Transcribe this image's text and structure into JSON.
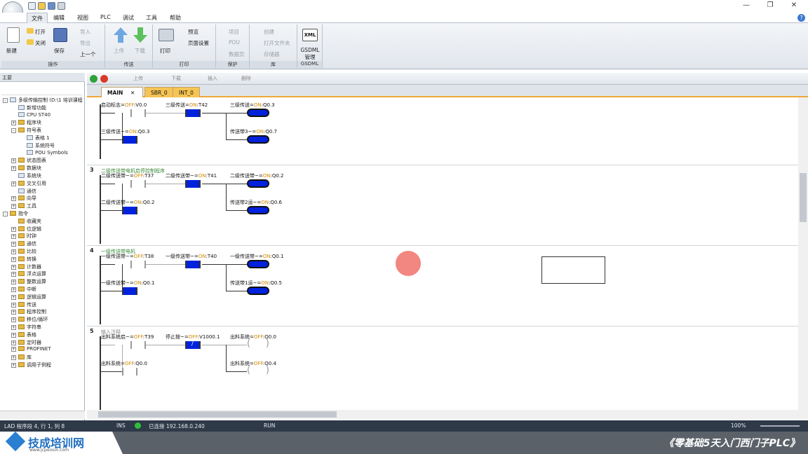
{
  "quick_access": [
    "new-icon",
    "open-icon",
    "save-icon",
    "print-icon"
  ],
  "window_controls": {
    "minimize": "—",
    "maximize": "❐",
    "close": "✕"
  },
  "menu": {
    "tabs": [
      "文件",
      "编辑",
      "视图",
      "PLC",
      "调试",
      "工具",
      "帮助"
    ],
    "active": 0
  },
  "ribbon": {
    "groups": [
      {
        "label": "操作",
        "items": [
          "新建",
          "打开",
          "关闭",
          "保存",
          "导入",
          "导出",
          "上一个"
        ]
      },
      {
        "label": "传送",
        "items": [
          "上传",
          "下载"
        ]
      },
      {
        "label": "打印",
        "items": [
          "打印",
          "预览",
          "页面设置"
        ]
      },
      {
        "label": "保护",
        "items": [
          "项目",
          "POU",
          "数据页"
        ]
      },
      {
        "label": "库",
        "items": [
          "创建",
          "打开文件夹",
          "存储器"
        ]
      },
      {
        "label": "GSDML",
        "items": [
          "GSDML 管理"
        ]
      }
    ],
    "xml_badge": "XML"
  },
  "left_pane": {
    "title": "主要",
    "tree": [
      {
        "label": "多级传输控制 (D:\\1 培训课程",
        "level": 0,
        "type": "root",
        "exp": "⊟"
      },
      {
        "label": "新增功能",
        "level": 1,
        "type": "item"
      },
      {
        "label": "CPU ST40",
        "level": 1,
        "type": "item"
      },
      {
        "label": "程序块",
        "level": 1,
        "type": "folder",
        "exp": "⊞"
      },
      {
        "label": "符号表",
        "level": 1,
        "type": "folder",
        "exp": "⊟"
      },
      {
        "label": "表格 1",
        "level": 2,
        "type": "item"
      },
      {
        "label": "系统符号",
        "level": 2,
        "type": "item"
      },
      {
        "label": "POU Symbols",
        "level": 2,
        "type": "item"
      },
      {
        "label": "状态图表",
        "level": 1,
        "type": "folder",
        "exp": "⊞"
      },
      {
        "label": "数据块",
        "level": 1,
        "type": "folder",
        "exp": "⊞"
      },
      {
        "label": "系统块",
        "level": 1,
        "type": "item"
      },
      {
        "label": "交叉引用",
        "level": 1,
        "type": "folder",
        "exp": "⊞"
      },
      {
        "label": "通信",
        "level": 1,
        "type": "item"
      },
      {
        "label": "向导",
        "level": 1,
        "type": "folder",
        "exp": "⊞"
      },
      {
        "label": "工具",
        "level": 1,
        "type": "folder",
        "exp": "⊞"
      },
      {
        "label": "指令",
        "level": 0,
        "type": "folder",
        "exp": "⊟"
      },
      {
        "label": "收藏夹",
        "level": 1,
        "type": "folder"
      },
      {
        "label": "位逻辑",
        "level": 1,
        "type": "folder",
        "exp": "⊞"
      },
      {
        "label": "时钟",
        "level": 1,
        "type": "folder",
        "exp": "⊞"
      },
      {
        "label": "通信",
        "level": 1,
        "type": "folder",
        "exp": "⊞"
      },
      {
        "label": "比较",
        "level": 1,
        "type": "folder",
        "exp": "⊞"
      },
      {
        "label": "转换",
        "level": 1,
        "type": "folder",
        "exp": "⊞"
      },
      {
        "label": "计数器",
        "level": 1,
        "type": "folder",
        "exp": "⊞"
      },
      {
        "label": "浮点运算",
        "level": 1,
        "type": "folder",
        "exp": "⊞"
      },
      {
        "label": "整数运算",
        "level": 1,
        "type": "folder",
        "exp": "⊞"
      },
      {
        "label": "中断",
        "level": 1,
        "type": "folder",
        "exp": "⊞"
      },
      {
        "label": "逻辑运算",
        "level": 1,
        "type": "folder",
        "exp": "⊞"
      },
      {
        "label": "传送",
        "level": 1,
        "type": "folder",
        "exp": "⊞"
      },
      {
        "label": "程序控制",
        "level": 1,
        "type": "folder",
        "exp": "⊞"
      },
      {
        "label": "移位/循环",
        "level": 1,
        "type": "folder",
        "exp": "⊞"
      },
      {
        "label": "字符串",
        "level": 1,
        "type": "folder",
        "exp": "⊞"
      },
      {
        "label": "表格",
        "level": 1,
        "type": "folder",
        "exp": "⊞"
      },
      {
        "label": "定时器",
        "level": 1,
        "type": "folder",
        "exp": "⊞"
      },
      {
        "label": "PROFINET",
        "level": 1,
        "type": "folder",
        "exp": "⊞"
      },
      {
        "label": "库",
        "level": 1,
        "type": "folder",
        "exp": "⊞"
      },
      {
        "label": "调用子例程",
        "level": 1,
        "type": "folder",
        "exp": "⊞"
      }
    ]
  },
  "editor_toolbar": {
    "upload": "上传",
    "download": "下载",
    "insert": "插入",
    "delete": "删除"
  },
  "doc_tabs": [
    {
      "label": "MAIN",
      "active": true,
      "close": "✕"
    },
    {
      "label": "SBR_0",
      "active": false
    },
    {
      "label": "INT_0",
      "active": false
    }
  ],
  "networks": [
    {
      "num": "",
      "comment": "",
      "row1": [
        {
          "name": "启动标志",
          "state": "OFF",
          "addr": "V0.0"
        },
        {
          "name": "三级传送",
          "state": "ON",
          "addr": "T42"
        },
        {
          "name": "三级传送",
          "state": "ON",
          "addr": "Q0.3"
        }
      ],
      "row2": [
        {
          "name": "三级传送~",
          "state": "ON",
          "addr": "Q0.3"
        },
        {
          "name": "传送带3~",
          "state": "ON",
          "addr": "Q0.7"
        }
      ]
    },
    {
      "num": "3",
      "comment": "二级传送带电机启停控制程序",
      "row1": [
        {
          "name": "二级传送带~",
          "state": "OFF",
          "addr": "T37"
        },
        {
          "name": "二级传送带~",
          "state": "ON",
          "addr": "T41"
        },
        {
          "name": "二级传送带~",
          "state": "ON",
          "addr": "Q0.2"
        }
      ],
      "row2": [
        {
          "name": "二级传送带~",
          "state": "ON",
          "addr": "Q0.2"
        },
        {
          "name": "传送带2运~",
          "state": "ON",
          "addr": "Q0.6"
        }
      ]
    },
    {
      "num": "4",
      "comment": "一级传送带电机",
      "row1": [
        {
          "name": "一级传送带~",
          "state": "OFF",
          "addr": "T38"
        },
        {
          "name": "一级传送带~",
          "state": "ON",
          "addr": "T40"
        },
        {
          "name": "一级传送带~",
          "state": "ON",
          "addr": "Q0.1"
        }
      ],
      "row2": [
        {
          "name": "一级传送带~",
          "state": "ON",
          "addr": "Q0.1"
        },
        {
          "name": "传送带1运~",
          "state": "ON",
          "addr": "Q0.5"
        }
      ]
    },
    {
      "num": "5",
      "comment": "输入注释",
      "row1": [
        {
          "name": "出料系统启~",
          "state": "OFF",
          "addr": "T39"
        },
        {
          "name": "停止按~",
          "state": "OFF",
          "addr": "V1000.1"
        },
        {
          "name": "出料系统",
          "state": "OFF",
          "addr": "Q0.0"
        }
      ],
      "row2": [
        {
          "name": "出料系统",
          "state": "OFF",
          "addr": "Q0.0"
        },
        {
          "name": "出料系统",
          "state": "OFF",
          "addr": "Q0.4"
        }
      ]
    }
  ],
  "cursor_marker_color": "#f0716a",
  "status": {
    "position": "LAD 程序段 4, 行 1, 列 8",
    "mode": "INS",
    "connection": "已连接 192.168.0.240",
    "run": "RUN",
    "zoom": "100%"
  },
  "branding": {
    "logo": "技成培训网",
    "url": "www.jcpeixun.com",
    "course": "《零基础5天入门西门子PLC》"
  }
}
